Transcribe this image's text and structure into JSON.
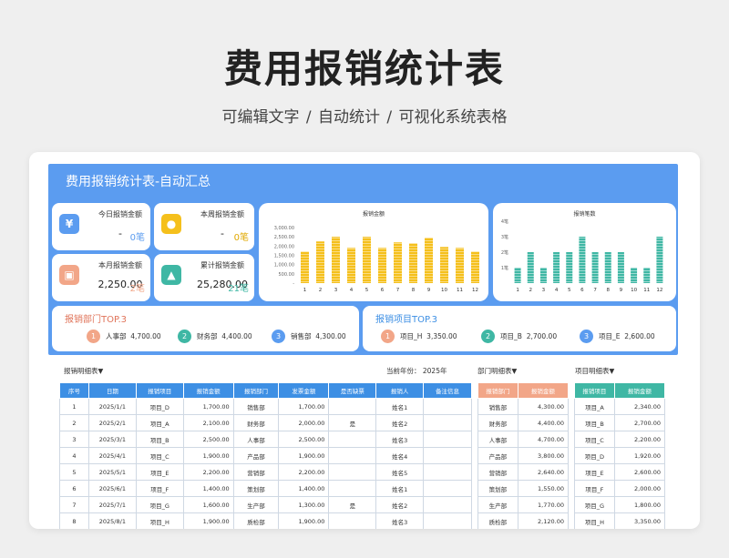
{
  "header": {
    "title": "费用报销统计表",
    "subtitle": "可编辑文字 / 自动统计 / 可视化系统表格"
  },
  "dashboard": {
    "title": "费用报销统计表-自动汇总"
  },
  "kpis": [
    {
      "label": "今日报销金额",
      "value": "-",
      "count": "0笔",
      "icon": "yen-icon",
      "color": "#5b9cf0",
      "count_color": "#5b9cf0"
    },
    {
      "label": "本周报销金额",
      "value": "-",
      "count": "0笔",
      "icon": "money-bag-icon",
      "color": "#f5c01c",
      "count_color": "#e0a800"
    },
    {
      "label": "本月报销金额",
      "value": "2,250.00",
      "count": "2笔",
      "icon": "wallet-icon",
      "color": "#f2a688",
      "count_color": "#f2a688"
    },
    {
      "label": "累计报销金额",
      "value": "25,280.00",
      "count": "21笔",
      "icon": "lock-bag-icon",
      "color": "#3fb7a4",
      "count_color": "#3fb7a4"
    }
  ],
  "chart_data": [
    {
      "type": "bar",
      "title": "报销金额",
      "categories": [
        "1",
        "2",
        "3",
        "4",
        "5",
        "6",
        "7",
        "8",
        "9",
        "10",
        "11",
        "12"
      ],
      "values": [
        1700,
        2250,
        2500,
        1900,
        2500,
        1900,
        2200,
        2150,
        2450,
        1950,
        1900,
        1700
      ],
      "yticks": [
        "3,000.00",
        "2,500.00",
        "2,000.00",
        "1,500.00",
        "1,000.00",
        "500.00",
        "-"
      ],
      "ylim": [
        0,
        3000
      ],
      "color": "#f5c01c"
    },
    {
      "type": "bar",
      "title": "报销笔数",
      "categories": [
        "1",
        "2",
        "3",
        "4",
        "5",
        "6",
        "7",
        "8",
        "9",
        "10",
        "11",
        "12"
      ],
      "values": [
        1,
        2,
        1,
        2,
        2,
        3,
        2,
        2,
        2,
        1,
        1,
        3
      ],
      "yticks": [
        "4笔",
        "3笔",
        "2笔",
        "1笔"
      ],
      "ylim": [
        0,
        4
      ],
      "color": "#3fb7a4"
    }
  ],
  "top3_dept": {
    "title": "报销部门TOP.3",
    "items": [
      {
        "rank": "1",
        "name": "人事部",
        "value": "4,700.00",
        "color": "#f2a688"
      },
      {
        "rank": "2",
        "name": "财务部",
        "value": "4,400.00",
        "color": "#3fb7a4"
      },
      {
        "rank": "3",
        "name": "销售部",
        "value": "4,300.00",
        "color": "#5b9cf0"
      }
    ]
  },
  "top3_proj": {
    "title": "报销项目TOP.3",
    "items": [
      {
        "rank": "1",
        "name": "项目_H",
        "value": "3,350.00",
        "color": "#f2a688"
      },
      {
        "rank": "2",
        "name": "项目_B",
        "value": "2,700.00",
        "color": "#3fb7a4"
      },
      {
        "rank": "3",
        "name": "项目_E",
        "value": "2,600.00",
        "color": "#5b9cf0"
      }
    ]
  },
  "detail": {
    "label": "报销明细表▼",
    "year_label": "当前年份：",
    "year": "2025年",
    "headers": [
      "序号",
      "日期",
      "报销项目",
      "报销金额",
      "报销部门",
      "发票金额",
      "是否缺票",
      "报销人",
      "备注信息"
    ],
    "rows": [
      [
        "1",
        "2025/1/1",
        "项目_D",
        "1,700.00",
        "销售部",
        "1,700.00",
        "",
        "姓名1",
        ""
      ],
      [
        "2",
        "2025/2/1",
        "项目_A",
        "2,100.00",
        "财务部",
        "2,000.00",
        "是",
        "姓名2",
        ""
      ],
      [
        "3",
        "2025/3/1",
        "项目_B",
        "2,500.00",
        "人事部",
        "2,500.00",
        "",
        "姓名3",
        ""
      ],
      [
        "4",
        "2025/4/1",
        "项目_C",
        "1,900.00",
        "产品部",
        "1,900.00",
        "",
        "姓名4",
        ""
      ],
      [
        "5",
        "2025/5/1",
        "项目_E",
        "2,200.00",
        "营销部",
        "2,200.00",
        "",
        "姓名5",
        ""
      ],
      [
        "6",
        "2025/6/1",
        "项目_F",
        "1,400.00",
        "策划部",
        "1,400.00",
        "",
        "姓名1",
        ""
      ],
      [
        "7",
        "2025/7/1",
        "项目_G",
        "1,600.00",
        "生产部",
        "1,300.00",
        "是",
        "姓名2",
        ""
      ],
      [
        "8",
        "2025/8/1",
        "项目_H",
        "1,900.00",
        "质检部",
        "1,900.00",
        "",
        "姓名3",
        ""
      ]
    ]
  },
  "dept_detail": {
    "label": "部门明细表▼",
    "headers": [
      "报销部门",
      "报销金额"
    ],
    "rows": [
      [
        "销售部",
        "4,300.00"
      ],
      [
        "财务部",
        "4,400.00"
      ],
      [
        "人事部",
        "4,700.00"
      ],
      [
        "产品部",
        "3,800.00"
      ],
      [
        "营销部",
        "2,640.00"
      ],
      [
        "策划部",
        "1,550.00"
      ],
      [
        "生产部",
        "1,770.00"
      ],
      [
        "质检部",
        "2,120.00"
      ]
    ]
  },
  "proj_detail": {
    "label": "项目明细表▼",
    "headers": [
      "报销项目",
      "报销金额"
    ],
    "rows": [
      [
        "项目_A",
        "2,340.00"
      ],
      [
        "项目_B",
        "2,700.00"
      ],
      [
        "项目_C",
        "2,200.00"
      ],
      [
        "项目_D",
        "1,920.00"
      ],
      [
        "项目_E",
        "2,600.00"
      ],
      [
        "项目_F",
        "2,000.00"
      ],
      [
        "项目_G",
        "1,800.00"
      ],
      [
        "项目_H",
        "3,350.00"
      ]
    ]
  }
}
